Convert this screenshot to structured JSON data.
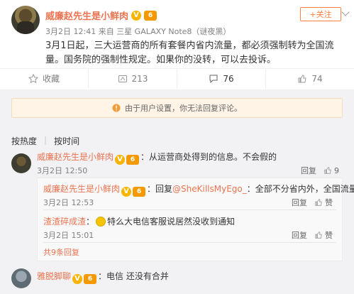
{
  "post": {
    "author": "威廉赵先生是小鲜肉",
    "meta": "3月2日 12:41 来自 三星 GALAXY Note8（谜夜黑）",
    "follow_label": "+关注",
    "text": "3月1日起，三大运营商的所有套餐内省内流量，都必须强制转为全国流量。国务院的强制性规定。如果你的没转，可以去投诉。",
    "actions": {
      "favorite": "收藏",
      "repost_count": "213",
      "comment_count": "76",
      "like_count": "74"
    }
  },
  "comments_section": {
    "notice": "由于用户设置，你无法回复评论。",
    "sort_hot": "按热度",
    "sort_time": "按时间",
    "comments": [
      {
        "author": "威廉赵先生是小鲜肉",
        "text": "：从运营商处得到的信息。不会假的",
        "time": "3月2日 12:50",
        "reply_label": "回复",
        "likes": "9",
        "replies": [
          {
            "author": "威廉赵先生是小鲜肉",
            "prefix": "：回复",
            "mention": "@SheKillsMyEgo_",
            "text": "：全部不分省内外，全国流量",
            "time": "3月2日 12:53",
            "reply_label": "回复",
            "like_label": "赞"
          },
          {
            "author": "渣渣碎成渣",
            "text": "特么大电信客服说居然没收到通知",
            "time": "3月2日 15:01",
            "reply_label": "回复",
            "like_label": "赞"
          }
        ],
        "more_replies": "共9条回复"
      },
      {
        "author": "雅脱脚聊",
        "text": "：电信 还没有合并"
      }
    ]
  },
  "colors": {
    "accent": "#eb7350",
    "follow": "#ff8140",
    "notice_bg": "#fff4e6",
    "comments_bg": "#f2f2f5"
  },
  "icons": [
    "chevron-down-icon",
    "star-icon",
    "repost-icon",
    "comment-icon",
    "like-icon",
    "info-icon",
    "verified-icon",
    "vip-icon"
  ]
}
